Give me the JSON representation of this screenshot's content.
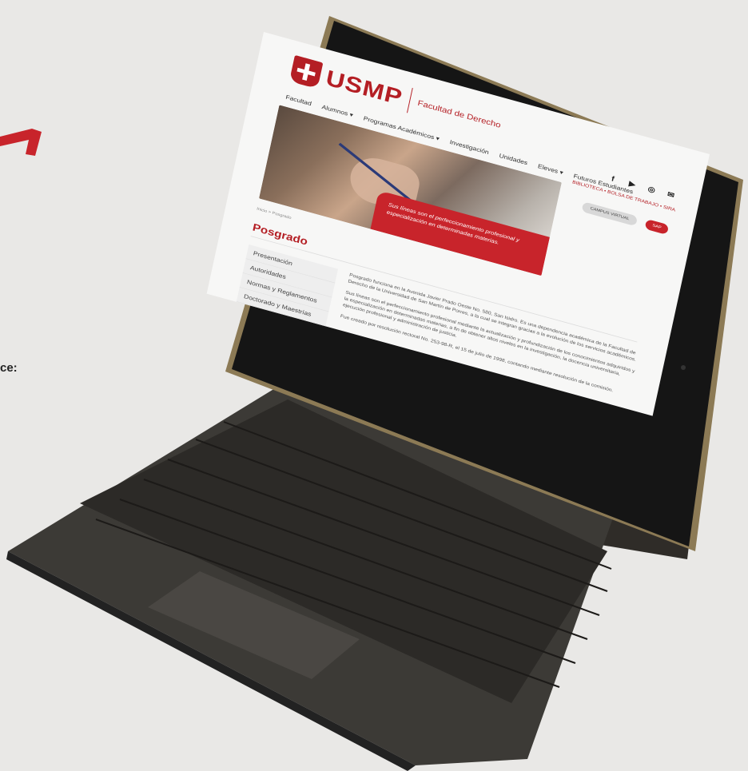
{
  "background": {
    "left_label": "ce:",
    "accent_color": "#c8242b"
  },
  "site": {
    "logo_name": "USMP",
    "logo_sub": "Facultad de Derecho",
    "nav": [
      "Facultad",
      "Alumnos ▾",
      "Programas Académicos ▾",
      "Investigación",
      "Unidades",
      "Eleves ▾",
      "Futuros Estudiantes"
    ],
    "socials": [
      {
        "icon": "facebook-icon",
        "glyph": "f"
      },
      {
        "icon": "youtube-icon",
        "glyph": "▶"
      },
      {
        "icon": "instagram-icon",
        "glyph": "◎"
      },
      {
        "icon": "mail-icon",
        "glyph": "✉"
      }
    ],
    "links_right": "BIBLIOTECA • BOLSA DE TRABAJO • SIRA",
    "btn_campus": "CAMPUS VIRTUAL",
    "btn_sap": "SAP",
    "hero_banner": "Sus líneas son el perfeccionamiento profesional y especialización en determinadas materias.",
    "breadcrumb": "Inicio > Posgrado",
    "page_title": "Posgrado",
    "sidebar": [
      "Presentación",
      "Autoridades",
      "Normas y Reglamentos",
      "Doctorado y Maestrías"
    ],
    "content": [
      "Posgrado funciona en la Avenida Javier Prado Oeste No. 580, San Isidro. Es una dependencia académica de la Facultad de Derecho de la Universidad de San Martín de Porres, a la cual se integran gracias a la evolución de los servicios académicos.",
      "Sus líneas son el perfeccionamiento profesional mediante la actualización y profundización de los conocimientos adquiridos y la especialización en determinadas materias, a fin de obtener altos niveles en la investigación, la docencia universitaria, ejecución profesional y administración de justicia.",
      "Fue creado por resolución rectoral No. 253-98-R, el 15 de julio de 1998, contando mediante resolución de la comisión."
    ]
  }
}
